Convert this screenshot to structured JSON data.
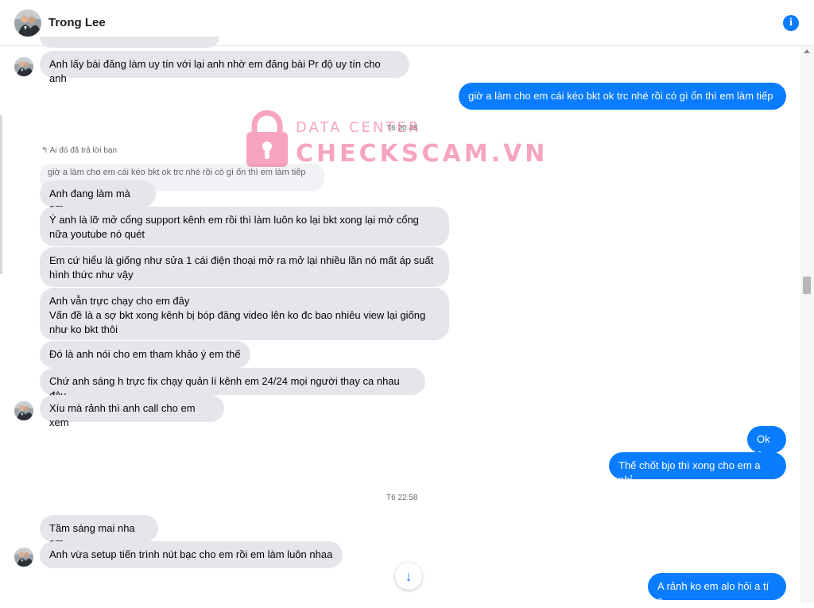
{
  "contact": {
    "name": "Trong Lee"
  },
  "icons": {
    "info": "info-icon",
    "scroll_down": "arrow-down-icon",
    "reply": "reply-arrow-icon"
  },
  "colors": {
    "accent": "#0a7cff",
    "incoming_bubble": "#e4e6eb",
    "watermark": "#f05a8e"
  },
  "watermark": {
    "line1": "DATA CENTER",
    "line2": "CHECKSCAM.VN",
    "icon": "padlock-icon"
  },
  "messages": [
    {
      "side": "in",
      "text": "Anh lấy bài đăng làm uy tín với lại anh nhờ em đăng bài Pr độ uy tín cho anh"
    },
    {
      "side": "out",
      "text": "giờ a làm cho em cái kéo bkt ok trc nhé rồi có gì ổn thì em làm tiếp"
    },
    {
      "side": "in",
      "text": "Anh đang làm mà em"
    },
    {
      "side": "in",
      "text": "Ý anh là lỡ mở cổng support kênh em rồi thì làm luôn ko lại bkt xong lại mở cổng\nnữa youtube nó quét"
    },
    {
      "side": "in",
      "text": "Em cứ hiểu là giống như sửa 1 cái điện thoại mở ra mở lại nhiều lần nó mất áp suất\nhình thức như vậy"
    },
    {
      "side": "in",
      "text": "Anh vẫn trực chạy cho em đây\nVấn đề là a sợ bkt xong kênh bị bóp đăng video lên ko đc bao nhiêu view lại giống\nnhư ko bkt thôi"
    },
    {
      "side": "in",
      "text": "Đó là anh nói cho em tham khảo ý em thế"
    },
    {
      "side": "in",
      "text": "Chứ anh sáng h trực fix chạy quản lí kênh em 24/24 mọi người thay ca nhau đây"
    },
    {
      "side": "in",
      "text": "Xíu mà rảnh thì anh call cho em xem"
    },
    {
      "side": "out",
      "text": "Ok a"
    },
    {
      "side": "out",
      "text": "Thế chốt bjo thì xong cho em a nhỉ"
    },
    {
      "side": "in",
      "text": "Tầm sáng mai nha em"
    },
    {
      "side": "in",
      "text": "Anh vừa setup tiến trình nút bạc cho em rồi em làm luôn nhaa"
    },
    {
      "side": "out",
      "text": "A rảnh ko em alo hỏi a tí ạ"
    }
  ],
  "timestamps": [
    "T6 20:48",
    "T6 22:58"
  ],
  "reply": {
    "note": "Ai đó đã trả lời bạn",
    "quoted": "giờ a làm cho em cái kéo bkt ok trc nhé rồi có gì ổn thì em làm tiếp"
  }
}
